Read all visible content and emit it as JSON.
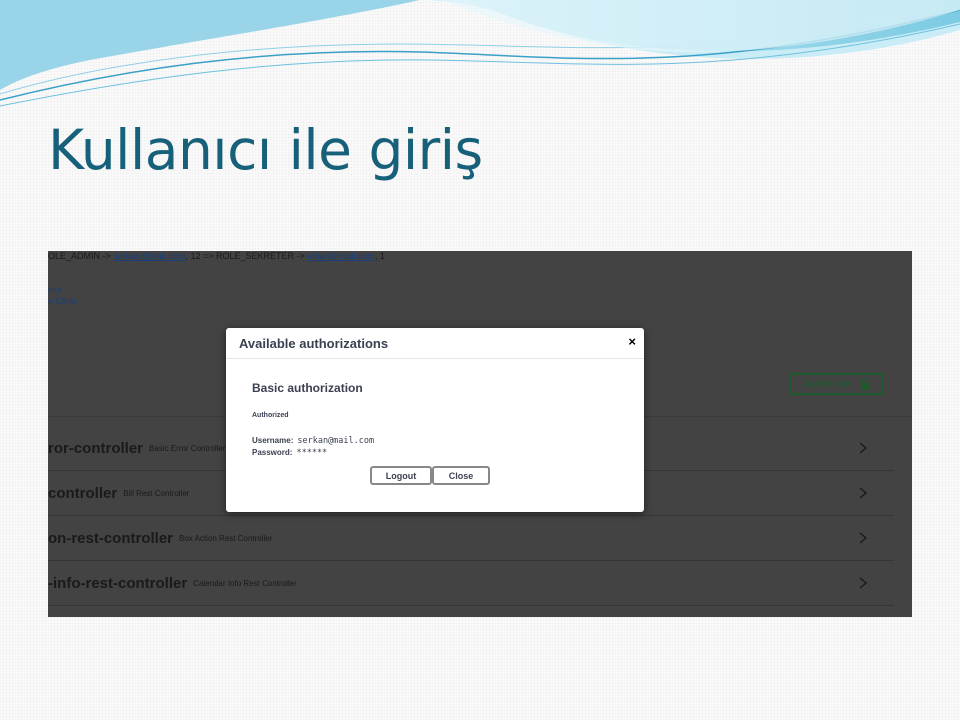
{
  "slide": {
    "title": "Kullanıcı ile giriş"
  },
  "underlay": {
    "roles_text": {
      "prefix": "OLE_ADMIN -> ",
      "link1": "serkan@mail.com",
      "middle": ", 12 => ROLE_SEKRETER -> ",
      "link2": "erkan@mail.com",
      "suffix": ", 1"
    },
    "small_link_1": "site",
    "small_link_2": "e Clinic",
    "authorize_label": "Authorize",
    "controllers": [
      {
        "name": "ror-controller",
        "description": "Basic Error Controller"
      },
      {
        "name": "controller",
        "description": "Bill Rest Controller"
      },
      {
        "name": "on-rest-controller",
        "description": "Box Action Rest Controller"
      },
      {
        "name": "-info-rest-controller",
        "description": "Calendar Info Rest Controller"
      }
    ]
  },
  "modal": {
    "title": "Available authorizations",
    "close_symbol": "×",
    "scheme_title": "Basic authorization",
    "status": "Authorized",
    "username_label": "Username:",
    "username_value": "serkan@mail.com",
    "password_label": "Password:",
    "password_value": "******",
    "logout_label": "Logout",
    "close_label": "Close"
  },
  "colors": {
    "title": "#17607a",
    "overlay": "#434343",
    "authorize": "#1d5a2c",
    "wave_light": "#bfe8f4",
    "wave_dark": "#5fbfdc"
  }
}
